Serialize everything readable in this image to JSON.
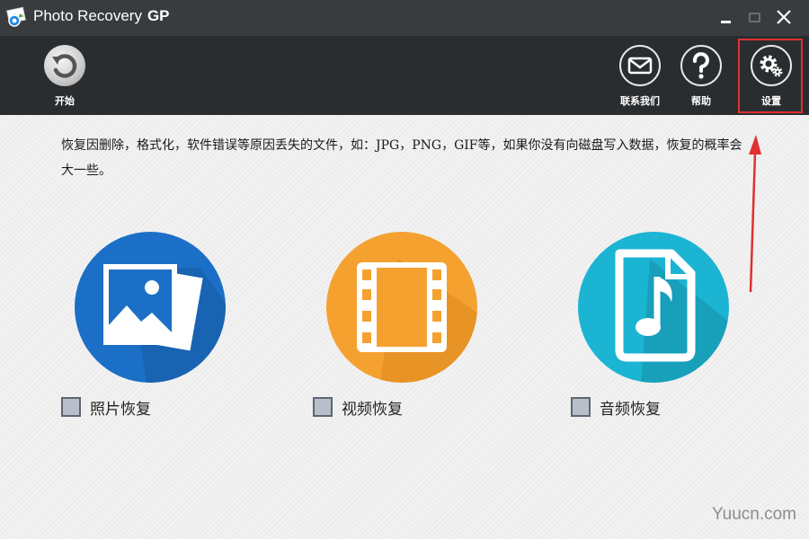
{
  "window": {
    "title": "Photo Recovery",
    "title_suffix": "GP"
  },
  "toolbar": {
    "start_label": "开始",
    "contact_label": "联系我们",
    "help_label": "帮助",
    "settings_label": "设置"
  },
  "main": {
    "description": "恢复因删除，格式化，软件错误等原因丢失的文件，如：JPG，PNG，GIF等，如果你没有向磁盘写入数据，恢复的概率会大一些。",
    "options": [
      {
        "label": "照片恢复",
        "icon": "photo-icon",
        "color": "#1b6fc6",
        "checked": false
      },
      {
        "label": "视频恢复",
        "icon": "film-icon",
        "color": "#f5a130",
        "checked": false
      },
      {
        "label": "音频恢复",
        "icon": "music-file-icon",
        "color": "#1cb4d3",
        "checked": false
      }
    ]
  },
  "watermark": "Yuucn.com",
  "colors": {
    "titlebar": "#393c3f",
    "toolbar": "#2a2d30",
    "highlight": "#e03030"
  }
}
